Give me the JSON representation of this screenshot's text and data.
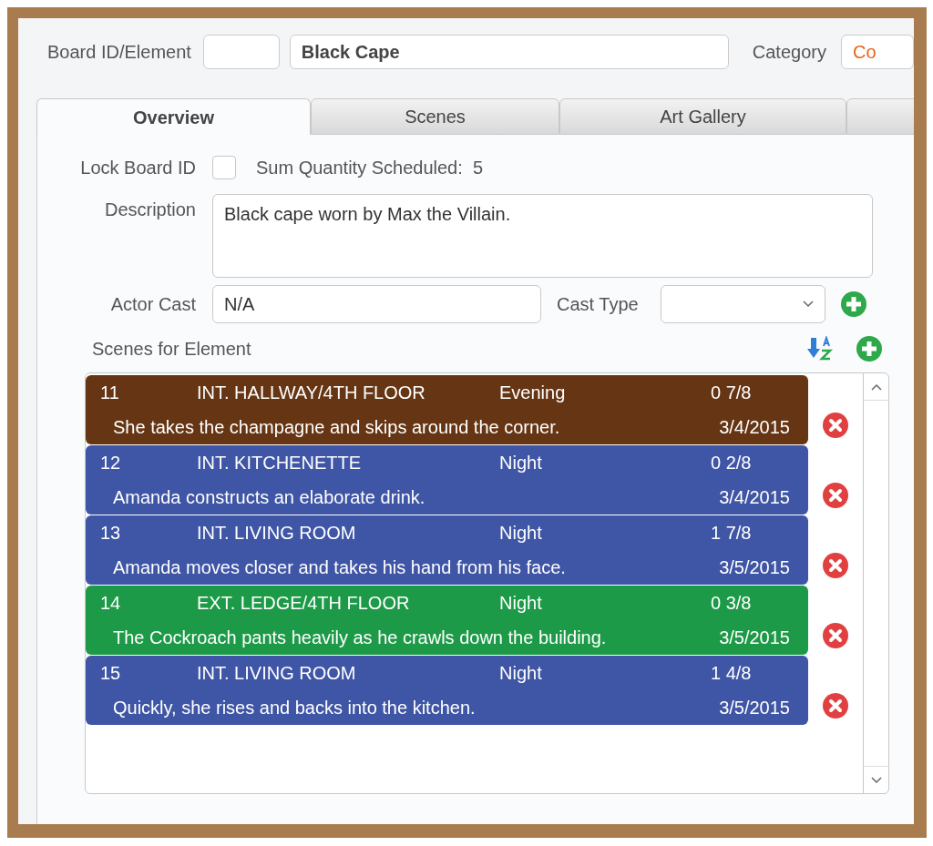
{
  "header": {
    "board_id_label": "Board ID/Element",
    "element_name": "Black Cape",
    "category_label": "Category",
    "category": "Co"
  },
  "tabs": [
    {
      "label": "Overview",
      "selected": true
    },
    {
      "label": "Scenes",
      "selected": false
    },
    {
      "label": "Art Gallery",
      "selected": false
    },
    {
      "selected": false
    }
  ],
  "overview": {
    "lock_board_id": {
      "label": "Lock Board ID",
      "checked": false
    },
    "sum_quantity": "Sum Quantity Scheduled:  5",
    "description_label": "Description",
    "description": "Black cape worn by Max the Villain.",
    "actor_cast_label": "Actor Cast",
    "actor_cast": "N/A",
    "cast_type_label": "Cast Type"
  },
  "scenes_label": "Scenes for Element",
  "scenes": [
    {
      "number": "11",
      "set": "INT. HALLWAY/4TH FLOOR",
      "time": "Evening",
      "pages": "0 7/8",
      "description": "She takes the champagne and skips around the corner.",
      "date": "3/4/2015",
      "color": "#653514"
    },
    {
      "number": "12",
      "set": "INT. KITCHENETTE",
      "time": "Night",
      "pages": "0 2/8",
      "description": "Amanda constructs an elaborate drink.",
      "date": "3/4/2015",
      "color": "#3f55a5"
    },
    {
      "number": "13",
      "set": "INT. LIVING ROOM",
      "time": "Night",
      "pages": "1 7/8",
      "description": "Amanda moves closer and takes his hand from his face.",
      "date": "3/5/2015",
      "color": "#3f55a5"
    },
    {
      "number": "14",
      "set": "EXT. LEDGE/4TH FLOOR",
      "time": "Night",
      "pages": "0 3/8",
      "description": "The Cockroach pants heavily as he crawls down the building.",
      "date": "3/5/2015",
      "color": "#1d9a47"
    },
    {
      "number": "15",
      "set": "INT. LIVING ROOM",
      "time": "Night",
      "pages": "1 4/8",
      "description": "Quickly, she rises and backs into the kitchen.",
      "date": "3/5/2015",
      "color": "#3f55a5"
    }
  ]
}
